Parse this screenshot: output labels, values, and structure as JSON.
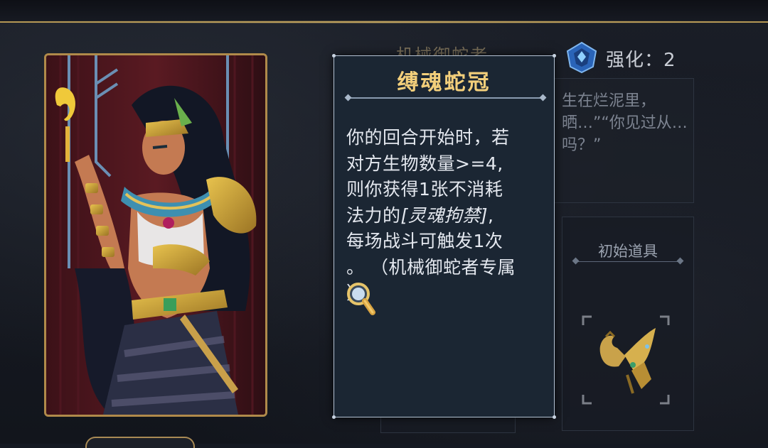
{
  "character": {
    "name": "机械御蛇者",
    "upgrade_label": "强化：2"
  },
  "lore": {
    "text": "生在烂泥里，晒…”“你见过从…吗？”"
  },
  "starting_item": {
    "label": "初始道具",
    "icon": "golden-bird-relic-icon"
  },
  "tooltip": {
    "title": "缚魂蛇冠",
    "line1": "你的回合开始时，若",
    "line2": "对方生物数量>=4,",
    "line3": "则你获得1张不消耗",
    "line4_prefix": "法力的",
    "line4_ref": "[灵魂拘禁]",
    "line4_suffix": ",",
    "line5": "每场战斗可触发1次",
    "line6": "。 （机械御蛇者专属",
    "line7": "）"
  },
  "colors": {
    "title_gold": "#f3cf7b",
    "frame_gold": "#b08a4a",
    "panel_bg": "#1b2633",
    "tooltip_border": "#b4c2d4"
  }
}
